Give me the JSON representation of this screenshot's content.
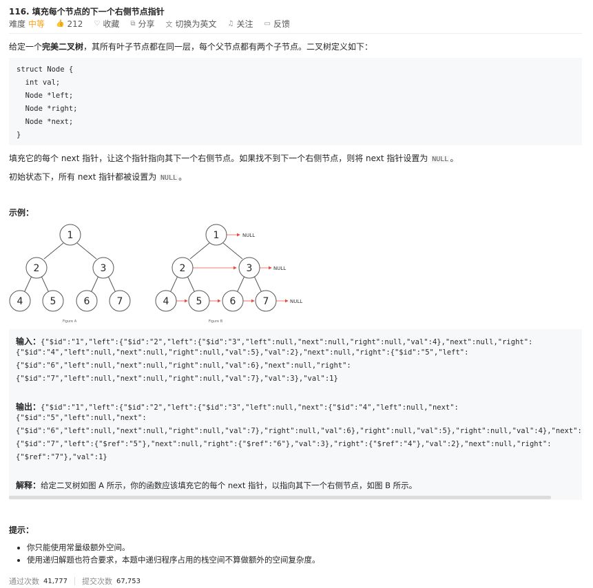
{
  "problem": {
    "title": "116. 填充每个节点的下一个右侧节点指针",
    "difficulty_label": "难度",
    "difficulty": "中等",
    "likes": "212",
    "favorite": "收藏",
    "share": "分享",
    "switch_lang": "切换为英文",
    "follow": "关注",
    "feedback": "反馈"
  },
  "desc": {
    "intro_prefix": "给定一个",
    "intro_bold": "完美二叉树",
    "intro_suffix": "，其所有叶子节点都在同一层，每个父节点都有两个子节点。二叉树定义如下：",
    "code": [
      "struct Node {",
      "  int val;",
      "  Node *left;",
      "  Node *right;",
      "  Node *next;",
      "}"
    ],
    "para1_a": "填充它的每个 next 指针，让这个指针指向其下一个右侧节点。如果找不到下一个右侧节点，则将 next 指针设置为 ",
    "para1_code": "NULL",
    "para1_b": "。",
    "para2_a": "初始状态下，所有 next 指针都被设置为 ",
    "para2_code": "NULL",
    "para2_b": "。"
  },
  "example": {
    "heading": "示例：",
    "figure_a": "Figure A",
    "figure_b": "Figure B",
    "null_label": "NULL",
    "nodes": [
      "1",
      "2",
      "3",
      "4",
      "5",
      "6",
      "7"
    ],
    "input_label": "输入：",
    "input_lines": [
      "{\"$id\":\"1\",\"left\":{\"$id\":\"2\",\"left\":{\"$id\":\"3\",\"left\":null,\"next\":null,\"right\":null,\"val\":4},\"next\":null,\"right\":",
      "{\"$id\":\"4\",\"left\":null,\"next\":null,\"right\":null,\"val\":5},\"val\":2},\"next\":null,\"right\":{\"$id\":\"5\",\"left\":",
      "{\"$id\":\"6\",\"left\":null,\"next\":null,\"right\":null,\"val\":6},\"next\":null,\"right\":",
      "{\"$id\":\"7\",\"left\":null,\"next\":null,\"right\":null,\"val\":7},\"val\":3},\"val\":1}"
    ],
    "output_label": "输出：",
    "output_lines": [
      "{\"$id\":\"1\",\"left\":{\"$id\":\"2\",\"left\":{\"$id\":\"3\",\"left\":null,\"next\":{\"$id\":\"4\",\"left\":null,\"next\":",
      "{\"$id\":\"5\",\"left\":null,\"next\":",
      "{\"$id\":\"6\",\"left\":null,\"next\":null,\"right\":null,\"val\":7},\"right\":null,\"val\":6},\"right\":null,\"val\":5},\"right\":null,\"val\":4},\"next\":",
      "{\"$id\":\"7\",\"left\":{\"$ref\":\"5\"},\"next\":null,\"right\":{\"$ref\":\"6\"},\"val\":3},\"right\":{\"$ref\":\"4\"},\"val\":2},\"next\":null,\"right\":",
      "{\"$ref\":\"7\"},\"val\":1}"
    ],
    "explain_label": "解释：",
    "explain_a": "给定二叉树如图 A 所示，你的函数应该填充它的每个 next 指针，以指向其下一个右侧节点，如图 B 所示。"
  },
  "hints": {
    "heading": "提示：",
    "items": [
      "你只能使用常量级额外空间。",
      "使用递归解题也符合要求，本题中递归程序占用的栈空间不算做额外的空间复杂度。"
    ]
  },
  "stats": {
    "accepted_label": "通过次数",
    "accepted": "41,777",
    "submitted_label": "提交次数",
    "submitted": "67,753"
  },
  "colors": {
    "accent": "#ffa116",
    "arrow": "#e84c3d"
  }
}
